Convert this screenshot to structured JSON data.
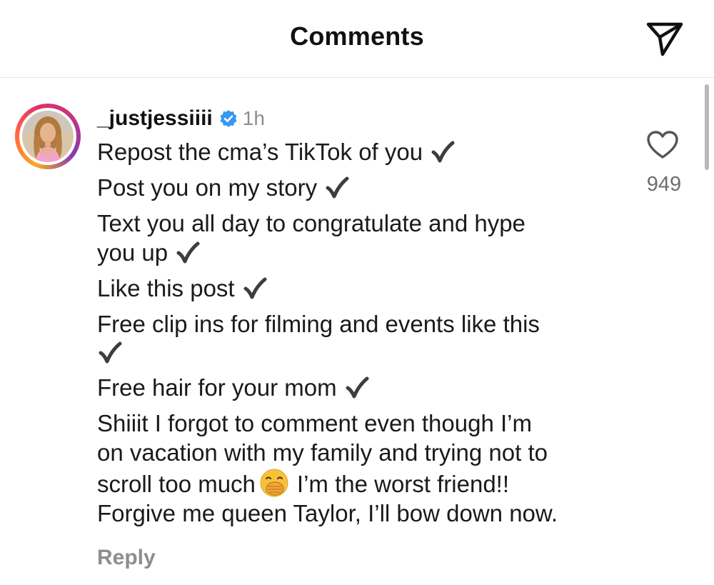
{
  "header": {
    "title": "Comments",
    "share_icon": "paper-plane-icon"
  },
  "comment": {
    "avatar_icon": "profile-photo-avatar",
    "username": "_justjessiiii",
    "verified_icon": "verified-badge-icon",
    "time": "1h",
    "text": {
      "line1": "Repost the cma’s TikTok of you",
      "line2": "Post you on my story",
      "line3": "Text you all day to congratulate and hype",
      "line4": "you up",
      "line5": "Like this post",
      "line6": "Free clip ins for filming and events like this",
      "line7": "Free hair for your mom",
      "line8": "Shiiit I forgot to comment even though I’m",
      "line9": "on vacation with my family and trying not to",
      "line10a": "scroll too much",
      "line10b": "I’m the worst friend!!",
      "line11": "Forgive me queen Taylor, I’ll bow down now."
    },
    "check_icon": "check-mark-icon",
    "emoji_icon": "face-with-hand-over-mouth-emoji",
    "reply_label": "Reply",
    "like_icon": "heart-icon",
    "like_count": "949"
  },
  "colors": {
    "text": "#111111",
    "muted": "#8e8e8e",
    "verified": "#3897f0",
    "divider": "#e4e4e4"
  }
}
